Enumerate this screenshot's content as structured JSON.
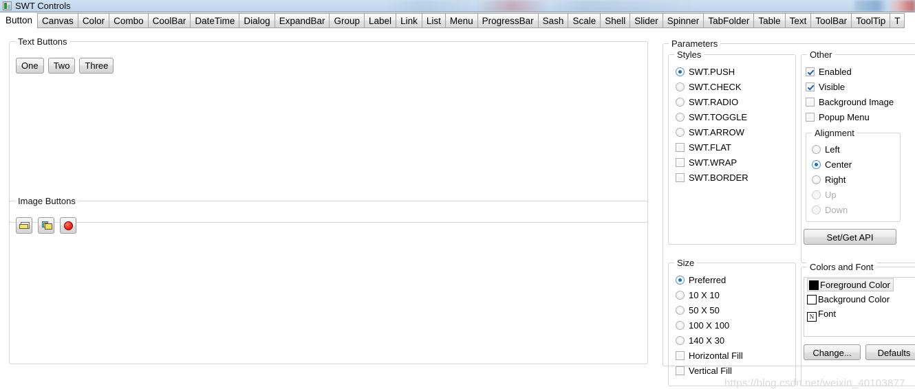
{
  "window": {
    "title": "SWT Controls",
    "icon": "app-icon"
  },
  "tabs": [
    {
      "label": "Button",
      "selected": true
    },
    {
      "label": "Canvas",
      "selected": false
    },
    {
      "label": "Color",
      "selected": false
    },
    {
      "label": "Combo",
      "selected": false
    },
    {
      "label": "CoolBar",
      "selected": false
    },
    {
      "label": "DateTime",
      "selected": false
    },
    {
      "label": "Dialog",
      "selected": false
    },
    {
      "label": "ExpandBar",
      "selected": false
    },
    {
      "label": "Group",
      "selected": false
    },
    {
      "label": "Label",
      "selected": false
    },
    {
      "label": "Link",
      "selected": false
    },
    {
      "label": "List",
      "selected": false
    },
    {
      "label": "Menu",
      "selected": false
    },
    {
      "label": "ProgressBar",
      "selected": false
    },
    {
      "label": "Sash",
      "selected": false
    },
    {
      "label": "Scale",
      "selected": false
    },
    {
      "label": "Shell",
      "selected": false
    },
    {
      "label": "Slider",
      "selected": false
    },
    {
      "label": "Spinner",
      "selected": false
    },
    {
      "label": "TabFolder",
      "selected": false
    },
    {
      "label": "Table",
      "selected": false
    },
    {
      "label": "Text",
      "selected": false
    },
    {
      "label": "ToolBar",
      "selected": false
    },
    {
      "label": "ToolTip",
      "selected": false
    },
    {
      "label": "T",
      "selected": false
    }
  ],
  "preview": {
    "text_buttons": {
      "title": "Text Buttons",
      "buttons": [
        {
          "label": "One"
        },
        {
          "label": "Two"
        },
        {
          "label": "Three"
        }
      ]
    },
    "image_buttons": {
      "title": "Image Buttons",
      "buttons": [
        {
          "icon": "folder-closed-icon"
        },
        {
          "icon": "folder-open-icon"
        },
        {
          "icon": "red-circle-icon"
        }
      ]
    }
  },
  "parameters": {
    "title": "Parameters",
    "styles": {
      "title": "Styles",
      "options": [
        {
          "label": "SWT.PUSH",
          "type": "radio",
          "checked": true,
          "enabled": true
        },
        {
          "label": "SWT.CHECK",
          "type": "radio",
          "checked": false,
          "enabled": true
        },
        {
          "label": "SWT.RADIO",
          "type": "radio",
          "checked": false,
          "enabled": true
        },
        {
          "label": "SWT.TOGGLE",
          "type": "radio",
          "checked": false,
          "enabled": true
        },
        {
          "label": "SWT.ARROW",
          "type": "radio",
          "checked": false,
          "enabled": true
        },
        {
          "label": "SWT.FLAT",
          "type": "checkbox",
          "checked": false,
          "enabled": true
        },
        {
          "label": "SWT.WRAP",
          "type": "checkbox",
          "checked": false,
          "enabled": true
        },
        {
          "label": "SWT.BORDER",
          "type": "checkbox",
          "checked": false,
          "enabled": true
        }
      ]
    },
    "size": {
      "title": "Size",
      "options": [
        {
          "label": "Preferred",
          "type": "radio",
          "checked": true,
          "enabled": true
        },
        {
          "label": "10 X 10",
          "type": "radio",
          "checked": false,
          "enabled": true
        },
        {
          "label": "50 X 50",
          "type": "radio",
          "checked": false,
          "enabled": true
        },
        {
          "label": "100 X 100",
          "type": "radio",
          "checked": false,
          "enabled": true
        },
        {
          "label": "140 X 30",
          "type": "radio",
          "checked": false,
          "enabled": true
        },
        {
          "label": "Horizontal Fill",
          "type": "checkbox",
          "checked": false,
          "enabled": true
        },
        {
          "label": "Vertical Fill",
          "type": "checkbox",
          "checked": false,
          "enabled": true
        }
      ]
    },
    "other": {
      "title": "Other",
      "options": [
        {
          "label": "Enabled",
          "type": "checkbox",
          "checked": true,
          "enabled": true
        },
        {
          "label": "Visible",
          "type": "checkbox",
          "checked": true,
          "enabled": true
        },
        {
          "label": "Background Image",
          "type": "checkbox",
          "checked": false,
          "enabled": true
        },
        {
          "label": "Popup Menu",
          "type": "checkbox",
          "checked": false,
          "enabled": true
        }
      ],
      "alignment": {
        "title": "Alignment",
        "options": [
          {
            "label": "Left",
            "type": "radio",
            "checked": false,
            "enabled": true
          },
          {
            "label": "Center",
            "type": "radio",
            "checked": true,
            "enabled": true
          },
          {
            "label": "Right",
            "type": "radio",
            "checked": false,
            "enabled": true
          },
          {
            "label": "Up",
            "type": "radio",
            "checked": false,
            "enabled": false
          },
          {
            "label": "Down",
            "type": "radio",
            "checked": false,
            "enabled": false
          }
        ]
      },
      "set_get_api_label": "Set/Get API"
    },
    "colors_and_font": {
      "title": "Colors and Font",
      "items": [
        {
          "label": "Foreground Color",
          "swatch": "black",
          "selected": true
        },
        {
          "label": "Background Color",
          "swatch": "white",
          "selected": false
        },
        {
          "label": "Font",
          "swatch": "fontglyph",
          "glyph": "N",
          "selected": false
        }
      ],
      "change_label": "Change...",
      "defaults_label": "Defaults"
    }
  },
  "watermark": {
    "text": "https://blog.csdn.net/weixin_40103877",
    "text_mid": "https://blog.csdn.net/weixin_40103877"
  },
  "colors": {
    "accent_radio": "#1f6fb0",
    "accent_check": "#2a5fa8",
    "group_border": "#d4d4d4",
    "titlebar": "#c6daef",
    "watermark": "#d9dbe4"
  }
}
